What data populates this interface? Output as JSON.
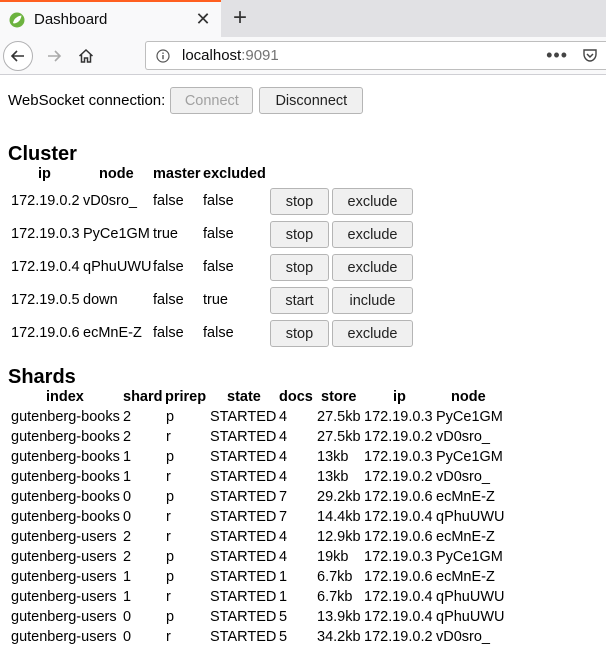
{
  "browser": {
    "tab_title": "Dashboard",
    "new_tab_symbol": "+",
    "close_symbol": "✕",
    "url_host": "localhost",
    "url_port": ":9091",
    "icons": [
      "leaf-icon",
      "close-icon",
      "plus-icon",
      "back-arrow-icon",
      "forward-arrow-icon",
      "home-icon",
      "info-icon",
      "more-dots-icon",
      "pocket-icon"
    ],
    "accent_color": "#ff5f1f"
  },
  "websocket": {
    "label": "WebSocket connection:",
    "connect_label": "Connect",
    "disconnect_label": "Disconnect"
  },
  "cluster": {
    "title": "Cluster",
    "headers": {
      "ip": "ip",
      "node": "node",
      "master": "master",
      "excluded": "excluded"
    },
    "rows": [
      {
        "ip": "172.19.0.2",
        "node": "vD0sro_",
        "master": "false",
        "excluded": "false",
        "action": "stop",
        "toggle": "exclude"
      },
      {
        "ip": "172.19.0.3",
        "node": "PyCe1GM",
        "master": "true",
        "excluded": "false",
        "action": "stop",
        "toggle": "exclude"
      },
      {
        "ip": "172.19.0.4",
        "node": "qPhuUWU",
        "master": "false",
        "excluded": "false",
        "action": "stop",
        "toggle": "exclude"
      },
      {
        "ip": "172.19.0.5",
        "node": "down",
        "master": "false",
        "excluded": "true",
        "action": "start",
        "toggle": "include"
      },
      {
        "ip": "172.19.0.6",
        "node": "ecMnE-Z",
        "master": "false",
        "excluded": "false",
        "action": "stop",
        "toggle": "exclude"
      }
    ]
  },
  "shards": {
    "title": "Shards",
    "headers": {
      "index": "index",
      "shard": "shard",
      "prirep": "prirep",
      "state": "state",
      "docs": "docs",
      "store": "store",
      "ip": "ip",
      "node": "node"
    },
    "rows": [
      {
        "index": "gutenberg-books",
        "shard": "2",
        "prirep": "p",
        "state": "STARTED",
        "docs": "4",
        "store": "27.5kb",
        "ip": "172.19.0.3",
        "node": "PyCe1GM"
      },
      {
        "index": "gutenberg-books",
        "shard": "2",
        "prirep": "r",
        "state": "STARTED",
        "docs": "4",
        "store": "27.5kb",
        "ip": "172.19.0.2",
        "node": "vD0sro_"
      },
      {
        "index": "gutenberg-books",
        "shard": "1",
        "prirep": "p",
        "state": "STARTED",
        "docs": "4",
        "store": "13kb",
        "ip": "172.19.0.3",
        "node": "PyCe1GM"
      },
      {
        "index": "gutenberg-books",
        "shard": "1",
        "prirep": "r",
        "state": "STARTED",
        "docs": "4",
        "store": "13kb",
        "ip": "172.19.0.2",
        "node": "vD0sro_"
      },
      {
        "index": "gutenberg-books",
        "shard": "0",
        "prirep": "p",
        "state": "STARTED",
        "docs": "7",
        "store": "29.2kb",
        "ip": "172.19.0.6",
        "node": "ecMnE-Z"
      },
      {
        "index": "gutenberg-books",
        "shard": "0",
        "prirep": "r",
        "state": "STARTED",
        "docs": "7",
        "store": "14.4kb",
        "ip": "172.19.0.4",
        "node": "qPhuUWU"
      },
      {
        "index": "gutenberg-users",
        "shard": "2",
        "prirep": "r",
        "state": "STARTED",
        "docs": "4",
        "store": "12.9kb",
        "ip": "172.19.0.6",
        "node": "ecMnE-Z"
      },
      {
        "index": "gutenberg-users",
        "shard": "2",
        "prirep": "p",
        "state": "STARTED",
        "docs": "4",
        "store": "19kb",
        "ip": "172.19.0.3",
        "node": "PyCe1GM"
      },
      {
        "index": "gutenberg-users",
        "shard": "1",
        "prirep": "p",
        "state": "STARTED",
        "docs": "1",
        "store": "6.7kb",
        "ip": "172.19.0.6",
        "node": "ecMnE-Z"
      },
      {
        "index": "gutenberg-users",
        "shard": "1",
        "prirep": "r",
        "state": "STARTED",
        "docs": "1",
        "store": "6.7kb",
        "ip": "172.19.0.4",
        "node": "qPhuUWU"
      },
      {
        "index": "gutenberg-users",
        "shard": "0",
        "prirep": "p",
        "state": "STARTED",
        "docs": "5",
        "store": "13.9kb",
        "ip": "172.19.0.4",
        "node": "qPhuUWU"
      },
      {
        "index": "gutenberg-users",
        "shard": "0",
        "prirep": "r",
        "state": "STARTED",
        "docs": "5",
        "store": "34.2kb",
        "ip": "172.19.0.2",
        "node": "vD0sro_"
      }
    ]
  }
}
